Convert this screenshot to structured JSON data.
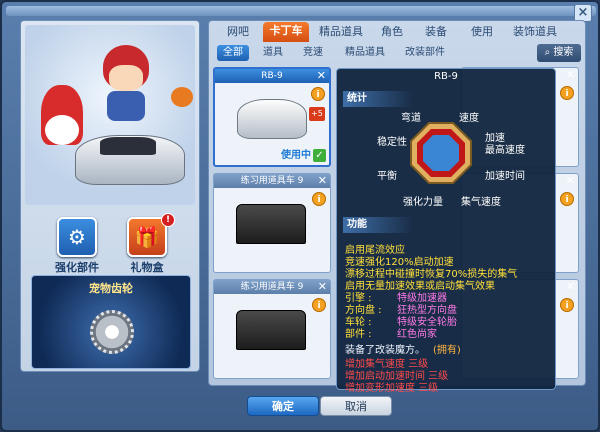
{
  "main_tabs": [
    "网吧",
    "卡丁车",
    "精品道具",
    "角色",
    "装备",
    "使用",
    "装饰道具"
  ],
  "active_main_tab": 1,
  "sub_tabs": [
    "全部",
    "道具",
    "竞速",
    "精品道具",
    "改装部件"
  ],
  "search_label": "搜索",
  "left": {
    "upgrade_label": "强化部件",
    "gift_label": "礼物盒",
    "gift_badge": "!",
    "pet_title": "宠物齿轮"
  },
  "cards": [
    {
      "title": "RB-9",
      "in_use": "使用中",
      "plus": "+5"
    },
    {
      "title": "练习用道具车 9"
    },
    {
      "title": "练习用道具车 9"
    }
  ],
  "tooltip": {
    "title": "RB-9",
    "stats_header": "统计",
    "stats": {
      "curve": "弯道",
      "speed": "速度",
      "stability": "稳定性",
      "accel": "加速",
      "max_speed": "最高速度",
      "balance": "平衡",
      "accel_time": "加速时间",
      "boost_power": "强化力量",
      "gather_speed": "集气速度"
    },
    "func_header": "功能",
    "func_lines": [
      "启用尾流效应",
      "竞速强化120%启动加速",
      "漂移过程中碰撞时恢复70%损失的集气",
      "启用无量加速效果或启动集气效果"
    ],
    "parts": [
      {
        "label": "引擎 :",
        "value": "特级加速器"
      },
      {
        "label": "方向盘 :",
        "value": "狂热型方向盘"
      },
      {
        "label": "车轮 :",
        "value": "特级安全轮胎"
      },
      {
        "label": "部件 :",
        "value": "红色尚家"
      }
    ],
    "magic_intro": "装备了改装魔方。",
    "magic_have": "(拥有)",
    "magic_lines": [
      "增加集气速度 三级",
      "增加启动加速时间 三级",
      "增加变形加速度 三级"
    ]
  },
  "buttons": {
    "ok": "确定",
    "cancel": "取消"
  },
  "colors": {
    "accent": "#d54e12",
    "highlight": "#1f60b2",
    "tooltip_bg": "#10243e"
  }
}
